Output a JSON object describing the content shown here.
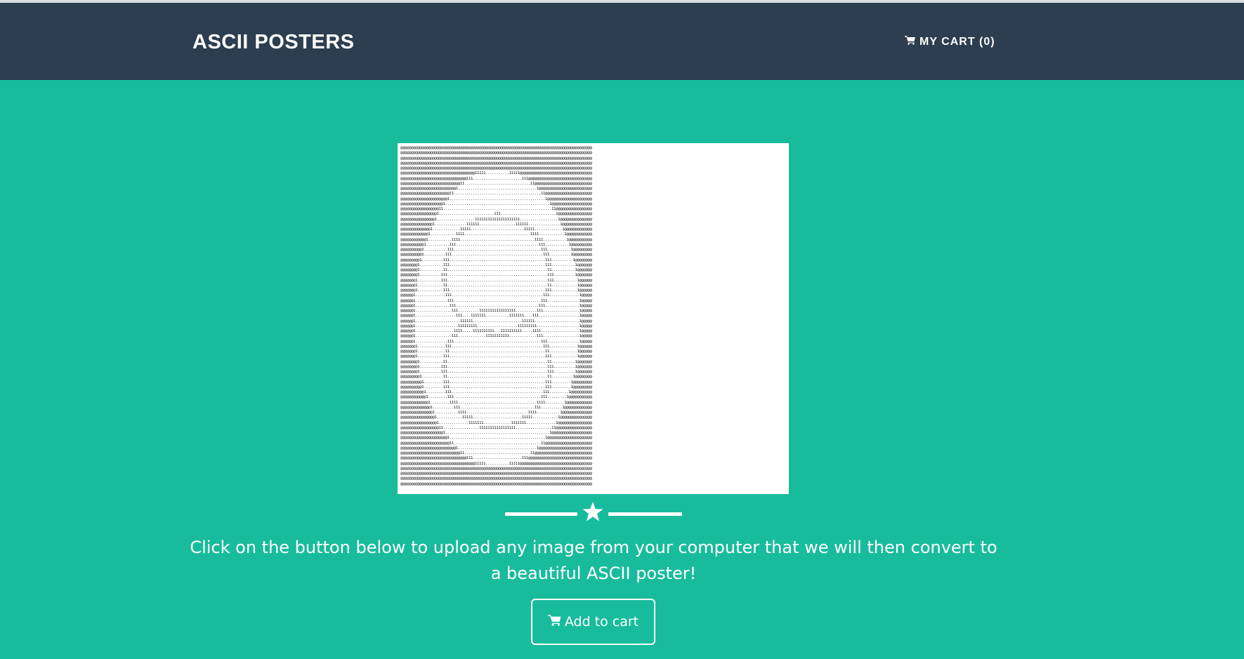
{
  "header": {
    "brand": "ASCII POSTERS",
    "cart_label": "MY CART (0)",
    "cart_icon": "shopping-cart-icon"
  },
  "main": {
    "poster_alt": "ASCII art poster",
    "divider_icon": "star-icon",
    "lead_text": "Click on the button below to upload any image from your computer that we will then convert to a beautiful ASCII poster!",
    "button_label": "Add to cart",
    "button_icon": "shopping-cart-icon"
  },
  "colors": {
    "navbar": "#2c3e50",
    "background": "#18bc9c",
    "text": "#ffffff"
  }
}
